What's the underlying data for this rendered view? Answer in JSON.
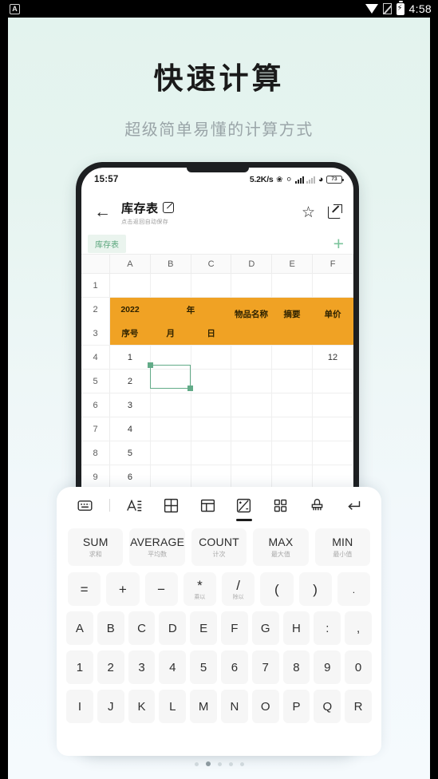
{
  "os_status": {
    "left_badge": "A",
    "wifi_icon": "wifi-icon",
    "nosim_icon": "no-sim-icon",
    "battery_icon": "battery-charging-icon",
    "clock": "4:58"
  },
  "hero": {
    "title": "快速计算",
    "subtitle": "超级简单易懂的计算方式"
  },
  "phone": {
    "status": {
      "time": "15:57",
      "net_speed": "5.2K/s",
      "bluetooth_icon": "bluetooth-icon",
      "mute_icon": "mute-icon",
      "signal_icon": "signal-bars-icon",
      "signal2_icon": "signal-bars-dim-icon",
      "wifi_icon": "wifi-icon",
      "battery_level": "73"
    },
    "header": {
      "back_icon": "back-arrow-icon",
      "title": "库存表",
      "edit_icon": "edit-icon",
      "subtitle": "点击返回自动保存",
      "star_icon": "star-icon",
      "share_icon": "share-icon"
    },
    "tabbar": {
      "sheet_name": "库存表",
      "add_icon": "plus-icon",
      "accent_color": "#5aa57c"
    },
    "sheet": {
      "columns": [
        "A",
        "B",
        "C",
        "D",
        "E",
        "F"
      ],
      "selection": {
        "cell": "B4",
        "color": "#62ab88"
      },
      "rows": [
        {
          "num": "1",
          "cells": [
            "",
            "",
            "",
            "",
            "",
            ""
          ],
          "style": "plain"
        },
        {
          "num": "2",
          "cells": [
            "2022",
            "年",
            "",
            "物品名称",
            "摘要",
            "单价"
          ],
          "style": "header-orange"
        },
        {
          "num": "3",
          "cells": [
            "序号",
            "月",
            "日",
            "",
            "",
            ""
          ],
          "style": "header-orange"
        },
        {
          "num": "4",
          "cells": [
            "1",
            "",
            "",
            "",
            "",
            "12"
          ],
          "style": "plain"
        },
        {
          "num": "5",
          "cells": [
            "2",
            "",
            "",
            "",
            "",
            ""
          ],
          "style": "plain"
        },
        {
          "num": "6",
          "cells": [
            "3",
            "",
            "",
            "",
            "",
            ""
          ],
          "style": "plain"
        },
        {
          "num": "7",
          "cells": [
            "4",
            "",
            "",
            "",
            "",
            ""
          ],
          "style": "plain"
        },
        {
          "num": "8",
          "cells": [
            "5",
            "",
            "",
            "",
            "",
            ""
          ],
          "style": "plain"
        },
        {
          "num": "9",
          "cells": [
            "6",
            "",
            "",
            "",
            "",
            ""
          ],
          "style": "plain"
        }
      ],
      "header_fill": "#f0a224"
    }
  },
  "keyboard": {
    "toolbar": [
      {
        "icon": "keyboard-icon",
        "active": false
      },
      {
        "icon": "text-format-icon",
        "active": false
      },
      {
        "icon": "table-grid-icon",
        "active": false
      },
      {
        "icon": "layout-icon",
        "active": false
      },
      {
        "icon": "calculator-icon",
        "active": true
      },
      {
        "icon": "apps-grid-icon",
        "active": false
      },
      {
        "icon": "eraser-icon",
        "active": false
      },
      {
        "icon": "enter-return-icon",
        "active": false
      }
    ],
    "functions": [
      {
        "en": "SUM",
        "cn": "求和"
      },
      {
        "en": "AVERAGE",
        "cn": "平均数"
      },
      {
        "en": "COUNT",
        "cn": "计次"
      },
      {
        "en": "MAX",
        "cn": "最大值"
      },
      {
        "en": "MIN",
        "cn": "最小值"
      }
    ],
    "operators": [
      {
        "sym": "=",
        "cn": ""
      },
      {
        "sym": "+",
        "cn": ""
      },
      {
        "sym": "−",
        "cn": ""
      },
      {
        "sym": "*",
        "cn": "乘以"
      },
      {
        "sym": "/",
        "cn": "除以"
      },
      {
        "sym": "(",
        "cn": ""
      },
      {
        "sym": ")",
        "cn": ""
      },
      {
        "sym": ".",
        "cn": ""
      }
    ],
    "key_rows": [
      [
        "A",
        "B",
        "C",
        "D",
        "E",
        "F",
        "G",
        "H",
        ":",
        ","
      ],
      [
        "1",
        "2",
        "3",
        "4",
        "5",
        "6",
        "7",
        "8",
        "9",
        "0"
      ],
      [
        "I",
        "J",
        "K",
        "L",
        "M",
        "N",
        "O",
        "P",
        "Q",
        "R"
      ]
    ]
  },
  "pager": {
    "count": 5,
    "active_index": 1
  }
}
